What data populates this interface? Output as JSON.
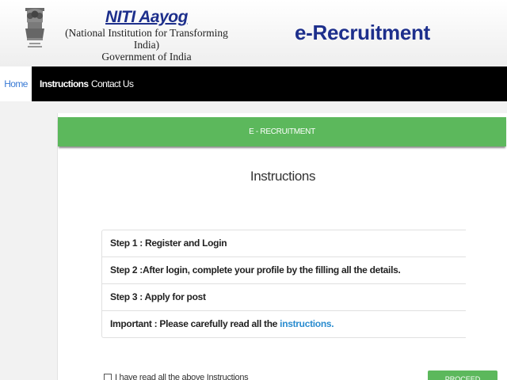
{
  "header": {
    "org_name": "NITI Aayog",
    "org_full_name": "(National Institution for Transforming India)",
    "org_government": "Government of India",
    "app_title": "e-Recruitment"
  },
  "nav": {
    "items": [
      {
        "label": "Home"
      },
      {
        "label": "Instructions"
      },
      {
        "label": "Contact Us"
      }
    ]
  },
  "panel": {
    "header_label": "E - RECRUITMENT",
    "title": "Instructions",
    "steps": [
      {
        "label": "Step 1 :",
        "text": " Register and Login"
      },
      {
        "label": "Step 2 :",
        "text": "After login, complete your profile by the filling all the details."
      },
      {
        "label": "Step 3 :",
        "text": " Apply for post"
      }
    ],
    "important": {
      "label": "Important :",
      "text": " Please carefully read all the ",
      "link": "instructions."
    },
    "agree_label": "I have read all the above Instructions",
    "proceed_label": "PROCEED"
  },
  "colors": {
    "brand_blue": "#1d2f8c",
    "accent_green": "#5cb85c",
    "link_blue": "#2a8ccf"
  }
}
